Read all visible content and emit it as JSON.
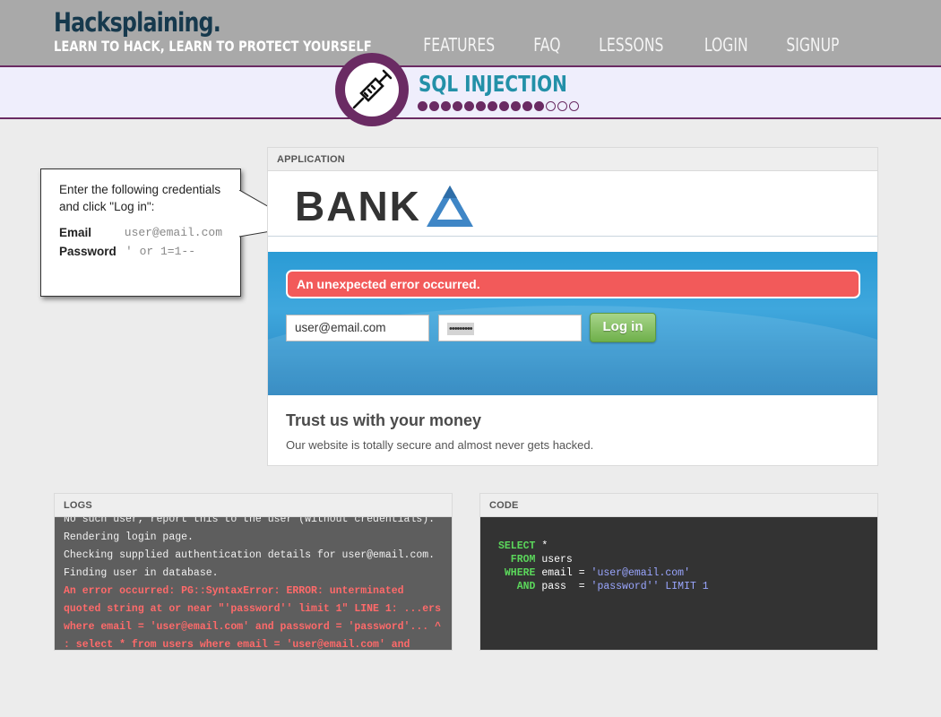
{
  "header": {
    "title": "Hacksplaining.",
    "tagline": "LEARN TO HACK, LEARN TO PROTECT YOURSELF",
    "nav": [
      "FEATURES",
      "FAQ",
      "LESSONS",
      "LOGIN",
      "SIGNUP"
    ]
  },
  "lesson": {
    "title": "SQL INJECTION",
    "icon": "syringe-icon",
    "progress": {
      "completed": 11,
      "total": 14
    }
  },
  "callout": {
    "instruction": "Enter the following credentials and click \"Log in\":",
    "email_label": "Email",
    "email_value": "user@email.com",
    "password_label": "Password",
    "password_value": "' or 1=1--"
  },
  "application": {
    "header": "APPLICATION",
    "logo_text": "BANK",
    "error_message": "An unexpected error occurred.",
    "email_value": "user@email.com",
    "password_mask": "•••••••••",
    "login_label": "Log in",
    "tagline_title": "Trust us with your money",
    "tagline_sub": "Our website is totally secure and almost never gets hacked."
  },
  "logs": {
    "header": "LOGS",
    "lines": [
      {
        "text": "No such user, report this to the user (without credentials).",
        "error": false
      },
      {
        "text": "Rendering login page.",
        "error": false
      },
      {
        "text": "Checking supplied authentication details for user@email.com.",
        "error": false
      },
      {
        "text": "Finding user in database.",
        "error": false
      },
      {
        "text": "An error occurred: PG::SyntaxError: ERROR: unterminated quoted string at or near \"'password'' limit 1\" LINE 1: ...ers where email = 'user@email.com' and password = 'password'... ^ : select * from users where email = 'user@email.com' and password",
        "error": true
      }
    ]
  },
  "code": {
    "header": "CODE",
    "lines": [
      [
        {
          "t": "SELECT",
          "c": "kw"
        },
        {
          "t": " *",
          "c": "plain"
        }
      ],
      [
        {
          "t": "  FROM",
          "c": "kw"
        },
        {
          "t": " users",
          "c": "plain"
        }
      ],
      [
        {
          "t": " WHERE",
          "c": "kw"
        },
        {
          "t": " email = ",
          "c": "plain"
        },
        {
          "t": "'user@email.com'",
          "c": "str"
        }
      ],
      [
        {
          "t": "   AND",
          "c": "kw"
        },
        {
          "t": " pass  = ",
          "c": "plain"
        },
        {
          "t": "'password'' LIMIT 1",
          "c": "str"
        }
      ]
    ]
  },
  "colors": {
    "brand_dark": "#16394d",
    "lesson_accent": "#2390a8",
    "purple": "#6a2b63",
    "error_red": "#f25a5a",
    "login_green": "#6fb04b",
    "bank_blue": "#3f86c6"
  }
}
